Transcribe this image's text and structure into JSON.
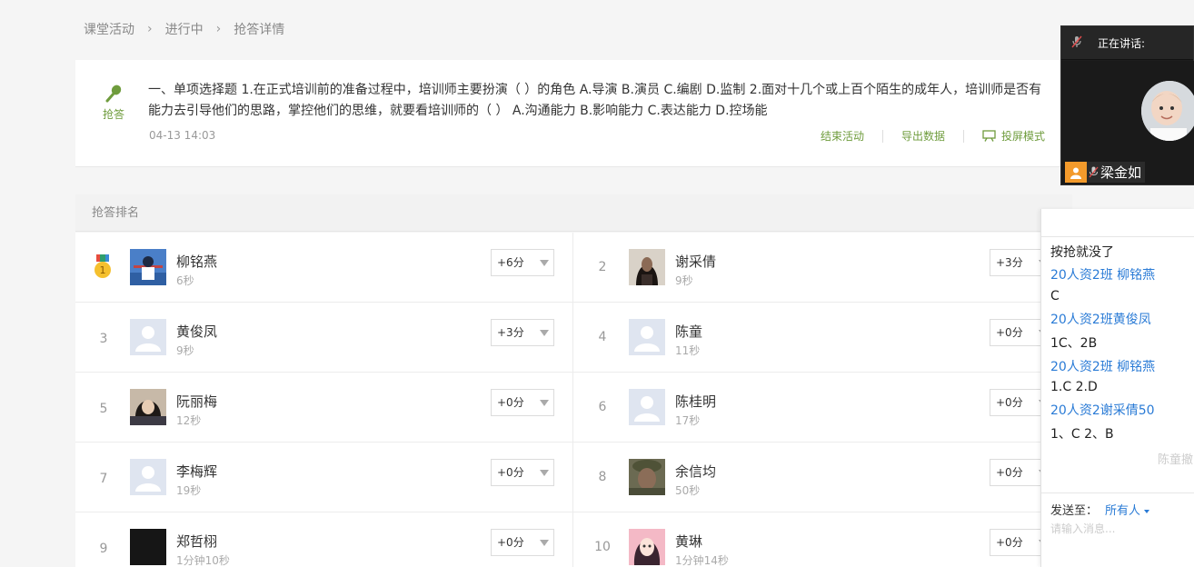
{
  "breadcrumb": [
    "课堂活动",
    "进行中",
    "抢答详情"
  ],
  "question": {
    "icon_label": "抢答",
    "text": "一、单项选择题 1.在正式培训前的准备过程中，培训师主要扮演（ ）的角色 A.导演 B.演员 C.编剧 D.监制 2.面对十几个或上百个陌生的成年人，培训师是否有能力去引导他们的思路，掌控他们的思维，就要看培训师的（ ） A.沟通能力 B.影响能力 C.表达能力 D.控场能",
    "time": "04-13 14:03",
    "actions": {
      "end": "结束活动",
      "export": "导出数据",
      "projection": "投屏模式"
    }
  },
  "ranking": {
    "header": "抢答排名",
    "rows": [
      {
        "rank": "1",
        "name": "柳铭燕",
        "time": "6秒",
        "score": "+6分",
        "avatar": "photo-blue"
      },
      {
        "rank": "2",
        "name": "谢采倩",
        "time": "9秒",
        "score": "+3分",
        "avatar": "photo-dark-hair"
      },
      {
        "rank": "3",
        "name": "黄俊凤",
        "time": "9秒",
        "score": "+3分",
        "avatar": "default"
      },
      {
        "rank": "4",
        "name": "陈童",
        "time": "11秒",
        "score": "+0分",
        "avatar": "default"
      },
      {
        "rank": "5",
        "name": "阮丽梅",
        "time": "12秒",
        "score": "+0分",
        "avatar": "photo-girl"
      },
      {
        "rank": "6",
        "name": "陈桂明",
        "time": "17秒",
        "score": "+0分",
        "avatar": "default"
      },
      {
        "rank": "7",
        "name": "李梅辉",
        "time": "19秒",
        "score": "+0分",
        "avatar": "default"
      },
      {
        "rank": "8",
        "name": "余信均",
        "time": "50秒",
        "score": "+0分",
        "avatar": "photo-soldier"
      },
      {
        "rank": "9",
        "name": "郑哲栩",
        "time": "1分钟10秒",
        "score": "+0分",
        "avatar": "photo-black"
      },
      {
        "rank": "10",
        "name": "黄琳",
        "time": "1分钟14秒",
        "score": "+0分",
        "avatar": "photo-cartoon"
      }
    ]
  },
  "video": {
    "status": "正在讲话:",
    "speaker": "梁金如"
  },
  "chat": {
    "messages": [
      {
        "type": "msg",
        "text": "按抢就没了"
      },
      {
        "type": "sender",
        "text": "20人资2班 柳铭燕"
      },
      {
        "type": "msg",
        "text": "C"
      },
      {
        "type": "sender",
        "text": "20人资2班黄俊凤"
      },
      {
        "type": "msg",
        "text": "1C、2B"
      },
      {
        "type": "sender",
        "text": "20人资2班 柳铭燕"
      },
      {
        "type": "msg",
        "text": "1.C 2.D"
      },
      {
        "type": "sender",
        "text": "20人资2谢采倩50"
      },
      {
        "type": "msg",
        "text": "1、C 2、B"
      }
    ],
    "faded": "陈童撤",
    "send_to_label": "发送至：",
    "send_target": "所有人",
    "input_placeholder": "请输入消息..."
  },
  "colors": {
    "accent_green": "#6f9c3d",
    "link_blue": "#2a7bd6",
    "medal_gold": "#f5c02e",
    "user_orange": "#f39a2b"
  }
}
